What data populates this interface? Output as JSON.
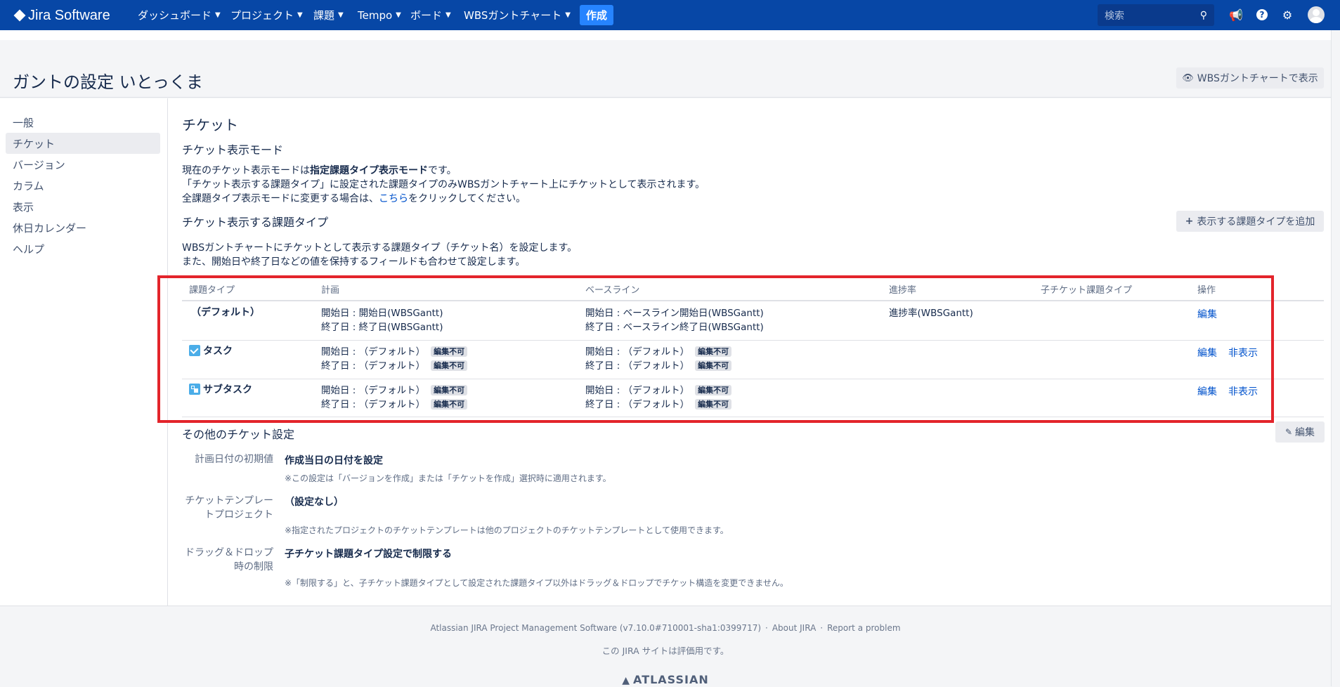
{
  "topnav": {
    "logo": "Jira Software",
    "items": [
      "ダッシュボード",
      "プロジェクト",
      "課題",
      "Tempo",
      "ボード",
      "WBSガントチャート"
    ],
    "create": "作成",
    "search_placeholder": "検索",
    "help": "?"
  },
  "header": {
    "title": "ガントの設定 いとっくま",
    "view_button": "WBSガントチャートで表示"
  },
  "sidebar": {
    "items": [
      {
        "label": "一般"
      },
      {
        "label": "チケット"
      },
      {
        "label": "バージョン"
      },
      {
        "label": "カラム"
      },
      {
        "label": "表示"
      },
      {
        "label": "休日カレンダー"
      },
      {
        "label": "ヘルプ"
      }
    ],
    "active": "チケット"
  },
  "main": {
    "title": "チケット",
    "mode_heading": "チケット表示モード",
    "mode_line1_pre": "現在のチケット表示モードは",
    "mode_line1_bold": "指定課題タイプ表示モード",
    "mode_line1_post": "です。",
    "mode_line2": "「チケット表示する課題タイプ」に設定された課題タイプのみWBSガントチャート上にチケットとして表示されます。",
    "mode_line3_pre": "全課題タイプ表示モードに変更する場合は、",
    "mode_line3_link": "こちら",
    "mode_line3_post": "をクリックしてください。",
    "types_heading": "チケット表示する課題タイプ",
    "add_type_button": "表示する課題タイプを追加",
    "types_desc1": "WBSガントチャートにチケットとして表示する課題タイプ（チケット名）を設定します。",
    "types_desc2": "また、開始日や終了日などの値を保持するフィールドも合わせて設定します。",
    "table": {
      "columns": [
        "課題タイプ",
        "計画",
        "ベースライン",
        "進捗率",
        "子チケット課題タイプ",
        "操作"
      ],
      "rows": [
        {
          "type": "（デフォルト）",
          "plan_start": "開始日 : 開始日(WBSGantt)",
          "plan_end": "終了日 : 終了日(WBSGantt)",
          "base_start": "開始日 : ベースライン開始日(WBSGantt)",
          "base_end": "終了日 : ベースライン終了日(WBSGantt)",
          "progress": "進捗率(WBSGantt)",
          "edit": "編集"
        },
        {
          "type": "タスク",
          "icon": "task-icon",
          "plan_start": "開始日 : （デフォルト）",
          "plan_end": "終了日 : （デフォルト）",
          "base_start": "開始日 : （デフォルト）",
          "base_end": "終了日 : （デフォルト）",
          "lozenge": "編集不可",
          "edit": "編集",
          "hide": "非表示"
        },
        {
          "type": "サブタスク",
          "icon": "subtask-icon",
          "plan_start": "開始日 : （デフォルト）",
          "plan_end": "終了日 : （デフォルト）",
          "base_start": "開始日 : （デフォルト）",
          "base_end": "終了日 : （デフォルト）",
          "lozenge": "編集不可",
          "edit": "編集",
          "hide": "非表示"
        }
      ]
    },
    "other_heading": "その他のチケット設定",
    "other_edit_button": "編集",
    "settings": [
      {
        "label": "計画日付の初期値",
        "value": "作成当日の日付を設定",
        "note": "※この設定は「バージョンを作成」または「チケットを作成」選択時に適用されます。"
      },
      {
        "label_line1": "チケットテンプレー",
        "label_line2": "トプロジェクト",
        "value": "（設定なし）",
        "note": "※指定されたプロジェクトのチケットテンプレートは他のプロジェクトのチケットテンプレートとして使用できます。"
      },
      {
        "label_line1": "ドラッグ＆ドロップ",
        "label_line2": "時の制限",
        "value": "子チケット課題タイプ設定で制限する",
        "note": "※「制限する」と、子チケット課題タイプとして設定された課題タイプ以外はドラッグ＆ドロップでチケット構造を変更できません。"
      }
    ]
  },
  "footer": {
    "line1": "Atlassian JIRA Project Management Software (v7.10.0#710001-sha1:0399717)",
    "about": "About JIRA",
    "report": "Report a problem",
    "line2": "この JIRA サイトは評価用です。",
    "brand": "ATLASSIAN"
  },
  "colors": {
    "nav": "#0747a6",
    "accent": "#2684ff",
    "link": "#0052cc",
    "highlight": "#e3242b"
  }
}
